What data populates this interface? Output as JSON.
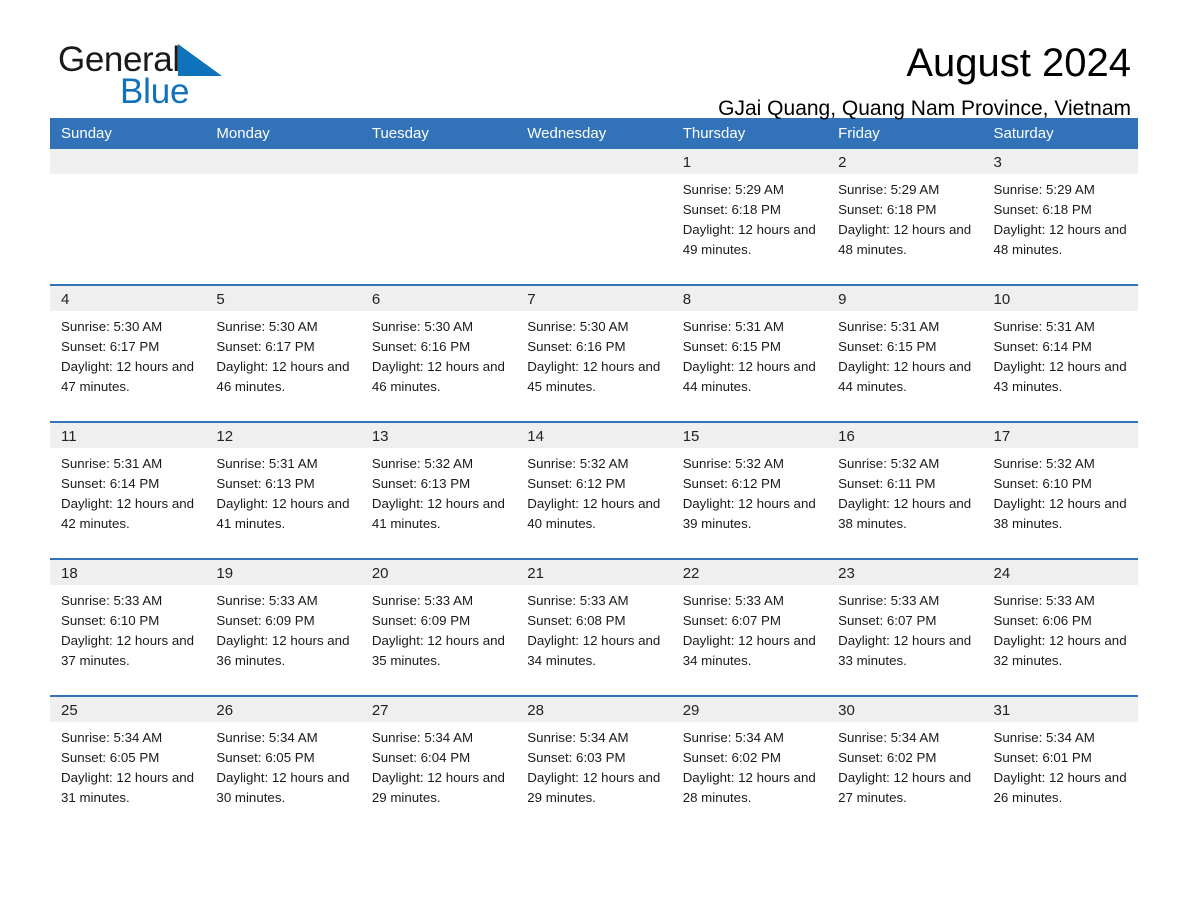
{
  "brand": {
    "word1": "General",
    "word2": "Blue",
    "triangle_color": "#1072ba",
    "icon": "brand-triangle-icon"
  },
  "header": {
    "title": "August 2024",
    "location": "GJai Quang, Quang Nam Province, Vietnam"
  },
  "theme": {
    "header_blue": "#3172b9",
    "daynum_gray": "#efefef",
    "accent_blue": "#1072ba"
  },
  "calendar": {
    "weekday_headers": [
      "Sunday",
      "Monday",
      "Tuesday",
      "Wednesday",
      "Thursday",
      "Friday",
      "Saturday"
    ],
    "weeks": [
      [
        {
          "day": "",
          "empty": true
        },
        {
          "day": "",
          "empty": true
        },
        {
          "day": "",
          "empty": true
        },
        {
          "day": "",
          "empty": true
        },
        {
          "day": "1",
          "sunrise": "Sunrise: 5:29 AM",
          "sunset": "Sunset: 6:18 PM",
          "daylight": "Daylight: 12 hours and 49 minutes."
        },
        {
          "day": "2",
          "sunrise": "Sunrise: 5:29 AM",
          "sunset": "Sunset: 6:18 PM",
          "daylight": "Daylight: 12 hours and 48 minutes."
        },
        {
          "day": "3",
          "sunrise": "Sunrise: 5:29 AM",
          "sunset": "Sunset: 6:18 PM",
          "daylight": "Daylight: 12 hours and 48 minutes."
        }
      ],
      [
        {
          "day": "4",
          "sunrise": "Sunrise: 5:30 AM",
          "sunset": "Sunset: 6:17 PM",
          "daylight": "Daylight: 12 hours and 47 minutes."
        },
        {
          "day": "5",
          "sunrise": "Sunrise: 5:30 AM",
          "sunset": "Sunset: 6:17 PM",
          "daylight": "Daylight: 12 hours and 46 minutes."
        },
        {
          "day": "6",
          "sunrise": "Sunrise: 5:30 AM",
          "sunset": "Sunset: 6:16 PM",
          "daylight": "Daylight: 12 hours and 46 minutes."
        },
        {
          "day": "7",
          "sunrise": "Sunrise: 5:30 AM",
          "sunset": "Sunset: 6:16 PM",
          "daylight": "Daylight: 12 hours and 45 minutes."
        },
        {
          "day": "8",
          "sunrise": "Sunrise: 5:31 AM",
          "sunset": "Sunset: 6:15 PM",
          "daylight": "Daylight: 12 hours and 44 minutes."
        },
        {
          "day": "9",
          "sunrise": "Sunrise: 5:31 AM",
          "sunset": "Sunset: 6:15 PM",
          "daylight": "Daylight: 12 hours and 44 minutes."
        },
        {
          "day": "10",
          "sunrise": "Sunrise: 5:31 AM",
          "sunset": "Sunset: 6:14 PM",
          "daylight": "Daylight: 12 hours and 43 minutes."
        }
      ],
      [
        {
          "day": "11",
          "sunrise": "Sunrise: 5:31 AM",
          "sunset": "Sunset: 6:14 PM",
          "daylight": "Daylight: 12 hours and 42 minutes."
        },
        {
          "day": "12",
          "sunrise": "Sunrise: 5:31 AM",
          "sunset": "Sunset: 6:13 PM",
          "daylight": "Daylight: 12 hours and 41 minutes."
        },
        {
          "day": "13",
          "sunrise": "Sunrise: 5:32 AM",
          "sunset": "Sunset: 6:13 PM",
          "daylight": "Daylight: 12 hours and 41 minutes."
        },
        {
          "day": "14",
          "sunrise": "Sunrise: 5:32 AM",
          "sunset": "Sunset: 6:12 PM",
          "daylight": "Daylight: 12 hours and 40 minutes."
        },
        {
          "day": "15",
          "sunrise": "Sunrise: 5:32 AM",
          "sunset": "Sunset: 6:12 PM",
          "daylight": "Daylight: 12 hours and 39 minutes."
        },
        {
          "day": "16",
          "sunrise": "Sunrise: 5:32 AM",
          "sunset": "Sunset: 6:11 PM",
          "daylight": "Daylight: 12 hours and 38 minutes."
        },
        {
          "day": "17",
          "sunrise": "Sunrise: 5:32 AM",
          "sunset": "Sunset: 6:10 PM",
          "daylight": "Daylight: 12 hours and 38 minutes."
        }
      ],
      [
        {
          "day": "18",
          "sunrise": "Sunrise: 5:33 AM",
          "sunset": "Sunset: 6:10 PM",
          "daylight": "Daylight: 12 hours and 37 minutes."
        },
        {
          "day": "19",
          "sunrise": "Sunrise: 5:33 AM",
          "sunset": "Sunset: 6:09 PM",
          "daylight": "Daylight: 12 hours and 36 minutes."
        },
        {
          "day": "20",
          "sunrise": "Sunrise: 5:33 AM",
          "sunset": "Sunset: 6:09 PM",
          "daylight": "Daylight: 12 hours and 35 minutes."
        },
        {
          "day": "21",
          "sunrise": "Sunrise: 5:33 AM",
          "sunset": "Sunset: 6:08 PM",
          "daylight": "Daylight: 12 hours and 34 minutes."
        },
        {
          "day": "22",
          "sunrise": "Sunrise: 5:33 AM",
          "sunset": "Sunset: 6:07 PM",
          "daylight": "Daylight: 12 hours and 34 minutes."
        },
        {
          "day": "23",
          "sunrise": "Sunrise: 5:33 AM",
          "sunset": "Sunset: 6:07 PM",
          "daylight": "Daylight: 12 hours and 33 minutes."
        },
        {
          "day": "24",
          "sunrise": "Sunrise: 5:33 AM",
          "sunset": "Sunset: 6:06 PM",
          "daylight": "Daylight: 12 hours and 32 minutes."
        }
      ],
      [
        {
          "day": "25",
          "sunrise": "Sunrise: 5:34 AM",
          "sunset": "Sunset: 6:05 PM",
          "daylight": "Daylight: 12 hours and 31 minutes."
        },
        {
          "day": "26",
          "sunrise": "Sunrise: 5:34 AM",
          "sunset": "Sunset: 6:05 PM",
          "daylight": "Daylight: 12 hours and 30 minutes."
        },
        {
          "day": "27",
          "sunrise": "Sunrise: 5:34 AM",
          "sunset": "Sunset: 6:04 PM",
          "daylight": "Daylight: 12 hours and 29 minutes."
        },
        {
          "day": "28",
          "sunrise": "Sunrise: 5:34 AM",
          "sunset": "Sunset: 6:03 PM",
          "daylight": "Daylight: 12 hours and 29 minutes."
        },
        {
          "day": "29",
          "sunrise": "Sunrise: 5:34 AM",
          "sunset": "Sunset: 6:02 PM",
          "daylight": "Daylight: 12 hours and 28 minutes."
        },
        {
          "day": "30",
          "sunrise": "Sunrise: 5:34 AM",
          "sunset": "Sunset: 6:02 PM",
          "daylight": "Daylight: 12 hours and 27 minutes."
        },
        {
          "day": "31",
          "sunrise": "Sunrise: 5:34 AM",
          "sunset": "Sunset: 6:01 PM",
          "daylight": "Daylight: 12 hours and 26 minutes."
        }
      ]
    ]
  }
}
